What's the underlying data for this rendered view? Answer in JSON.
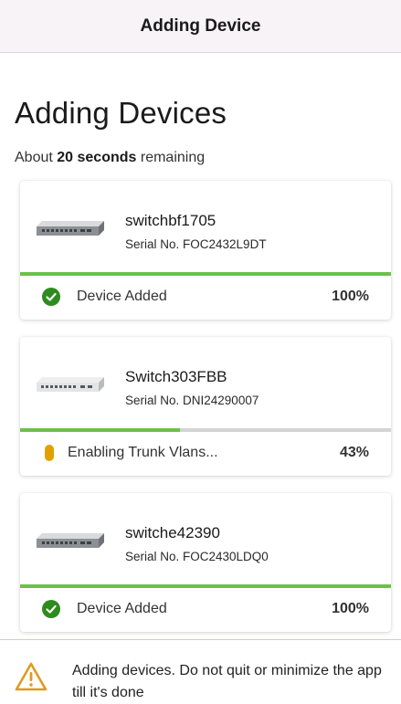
{
  "navbar": {
    "title": "Adding Device"
  },
  "header": {
    "title": "Adding Devices",
    "remaining_prefix": "About",
    "remaining_value": "20 seconds",
    "remaining_suffix": "remaining"
  },
  "devices": [
    {
      "name": "switchbf1705",
      "serial": "Serial No.  FOC2432L9DT",
      "progress": 1.0,
      "status": "Device Added",
      "percent": "100%",
      "state": "added"
    },
    {
      "name": "Switch303FBB",
      "serial": "Serial No.  DNI24290007",
      "progress": 0.43,
      "status": "Enabling Trunk Vlans...",
      "percent": "43%",
      "state": "in-progress"
    },
    {
      "name": "switche42390",
      "serial": "Serial No.  FOC2430LDQ0",
      "progress": 1.0,
      "status": "Device Added",
      "percent": "100%",
      "state": "added"
    }
  ],
  "footer": {
    "message": "Adding devices. Do not quit or minimize the app till it's done"
  },
  "icons": {
    "status_added": "check-circle-icon",
    "status_in_progress": "pending-pill-icon",
    "footer_warning": "warning-triangle-icon"
  },
  "colors": {
    "success": "#2e8b1e",
    "progress": "#6cc04a",
    "pending": "#e0a100",
    "warning": "#e09a20"
  }
}
